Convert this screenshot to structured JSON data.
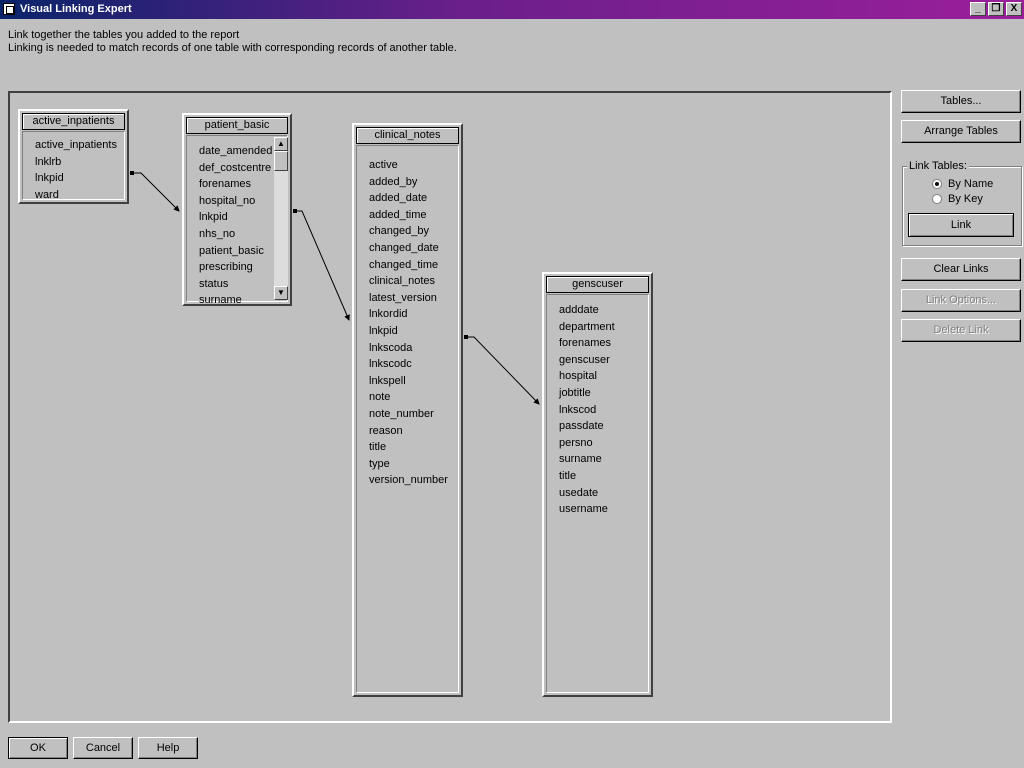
{
  "window": {
    "title": "Visual Linking Expert",
    "controls": [
      "_",
      "❐",
      "X"
    ]
  },
  "instructions": [
    "Link together the tables you added to the report",
    "Linking is needed to match records of one table with corresponding records of another table."
  ],
  "tables": [
    {
      "name": "active_inpatients",
      "fields": [
        "active_inpatients",
        "lnklrb",
        "lnkpid",
        "ward"
      ]
    },
    {
      "name": "patient_basic",
      "fields": [
        "date_amended",
        "def_costcentre",
        "forenames",
        "hospital_no",
        "lnkpid",
        "nhs_no",
        "patient_basic",
        "prescribing",
        "status",
        "surname"
      ]
    },
    {
      "name": "clinical_notes",
      "fields": [
        "active",
        "added_by",
        "added_date",
        "added_time",
        "changed_by",
        "changed_date",
        "changed_time",
        "clinical_notes",
        "latest_version",
        "lnkordid",
        "lnkpid",
        "lnkscoda",
        "lnkscodc",
        "lnkspell",
        "note",
        "note_number",
        "reason",
        "title",
        "type",
        "version_number"
      ]
    },
    {
      "name": "genscuser",
      "fields": [
        "adddate",
        "department",
        "forenames",
        "genscuser",
        "hospital",
        "jobtitle",
        "lnkscod",
        "passdate",
        "persno",
        "surname",
        "title",
        "usedate",
        "username"
      ]
    }
  ],
  "links": [
    {
      "from": "active_inpatients.lnkpid",
      "to": "patient_basic.lnkpid"
    },
    {
      "from": "patient_basic.forenames",
      "to": "clinical_notes.lnkpid"
    },
    {
      "from": "clinical_notes.lnkscoda",
      "to": "genscuser.lnkscod"
    }
  ],
  "side": {
    "tables_btn": "Tables...",
    "arrange_btn": "Arrange Tables",
    "link_tables_label": "Link Tables:",
    "by_name": "By Name",
    "by_key": "By Key",
    "selected_mode": "By Name",
    "link_btn": "Link",
    "clear_btn": "Clear Links",
    "options_btn": "Link Options...",
    "delete_btn": "Delete Link"
  },
  "bottom": {
    "ok": "OK",
    "cancel": "Cancel",
    "help": "Help"
  }
}
